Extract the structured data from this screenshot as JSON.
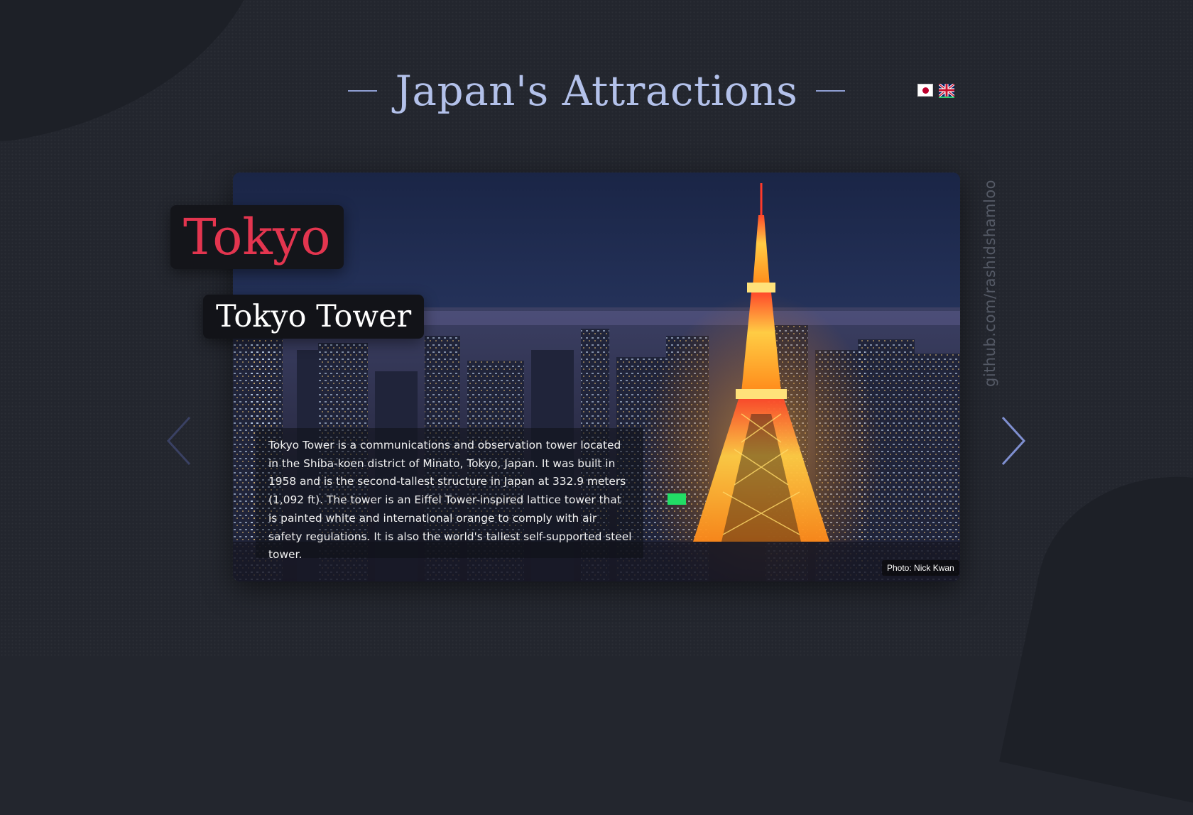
{
  "header": {
    "title": "Japan's Attractions"
  },
  "languages": [
    {
      "code": "ja",
      "icon": "japan-flag-icon",
      "active": false
    },
    {
      "code": "en",
      "icon": "uk-flag-icon",
      "active": true
    }
  ],
  "slide": {
    "city": "Tokyo",
    "place": "Tokyo Tower",
    "description": "Tokyo Tower is a communications and observation tower located in the Shiba-koen district of Minato, Tokyo, Japan. It was built in 1958 and is the second-tallest structure in Japan at 332.9 meters (1,092 ft). The tower is an Eiffel Tower-inspired lattice tower that is painted white and international orange to comply with air safety regulations. It is also the world's tallest self-supported steel tower.",
    "credit": "Photo: Nick Kwan"
  },
  "side_link": "github.com/rashidshamloo",
  "nav": {
    "prev_icon": "chevron-left-icon",
    "next_icon": "chevron-right-icon"
  },
  "colors": {
    "background": "#23262e",
    "title": "#b3c1ea",
    "city": "#e3354f",
    "accent": "#8f9fd3"
  }
}
